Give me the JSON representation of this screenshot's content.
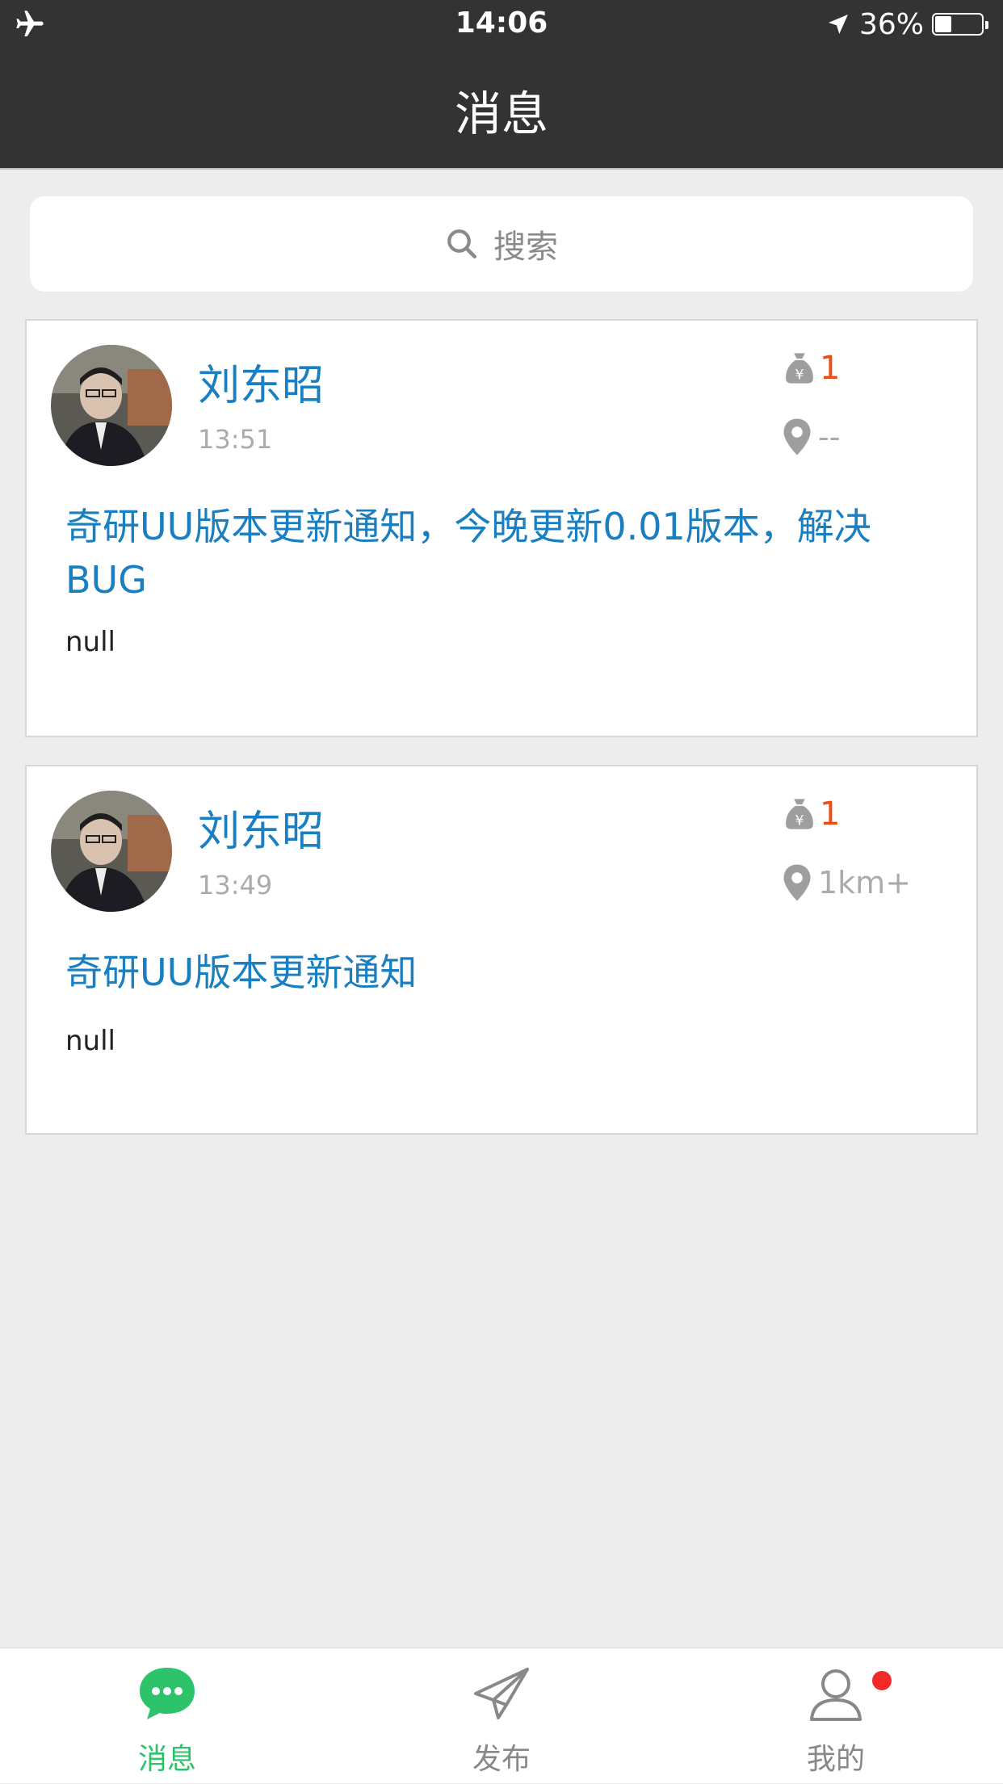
{
  "status_bar": {
    "time": "14:06",
    "battery_text": "36%",
    "battery_level": 0.36,
    "icons": [
      "airplane-mode-icon",
      "location-arrow-icon",
      "battery-icon"
    ]
  },
  "nav": {
    "title": "消息"
  },
  "search": {
    "placeholder": "搜索"
  },
  "messages": [
    {
      "author": "刘东昭",
      "time": "13:51",
      "reward": "1",
      "location": "--",
      "title": "奇研UU版本更新通知，今晚更新0.01版本，解决BUG",
      "body": "null"
    },
    {
      "author": "刘东昭",
      "time": "13:49",
      "reward": "1",
      "location": "1km+",
      "title": "奇研UU版本更新通知",
      "body": "null"
    }
  ],
  "tabs": [
    {
      "label": "消息",
      "icon": "chat-bubble-icon",
      "active": true
    },
    {
      "label": "发布",
      "icon": "paper-plane-icon",
      "active": false
    },
    {
      "label": "我的",
      "icon": "user-icon",
      "active": false,
      "badge": true
    }
  ],
  "colors": {
    "header_bg": "#333333",
    "page_bg": "#ededed",
    "link_blue": "#1a7fc1",
    "accent_green": "#2dc36a",
    "reward_orange": "#ee4b16",
    "badge_red": "#f22929"
  }
}
